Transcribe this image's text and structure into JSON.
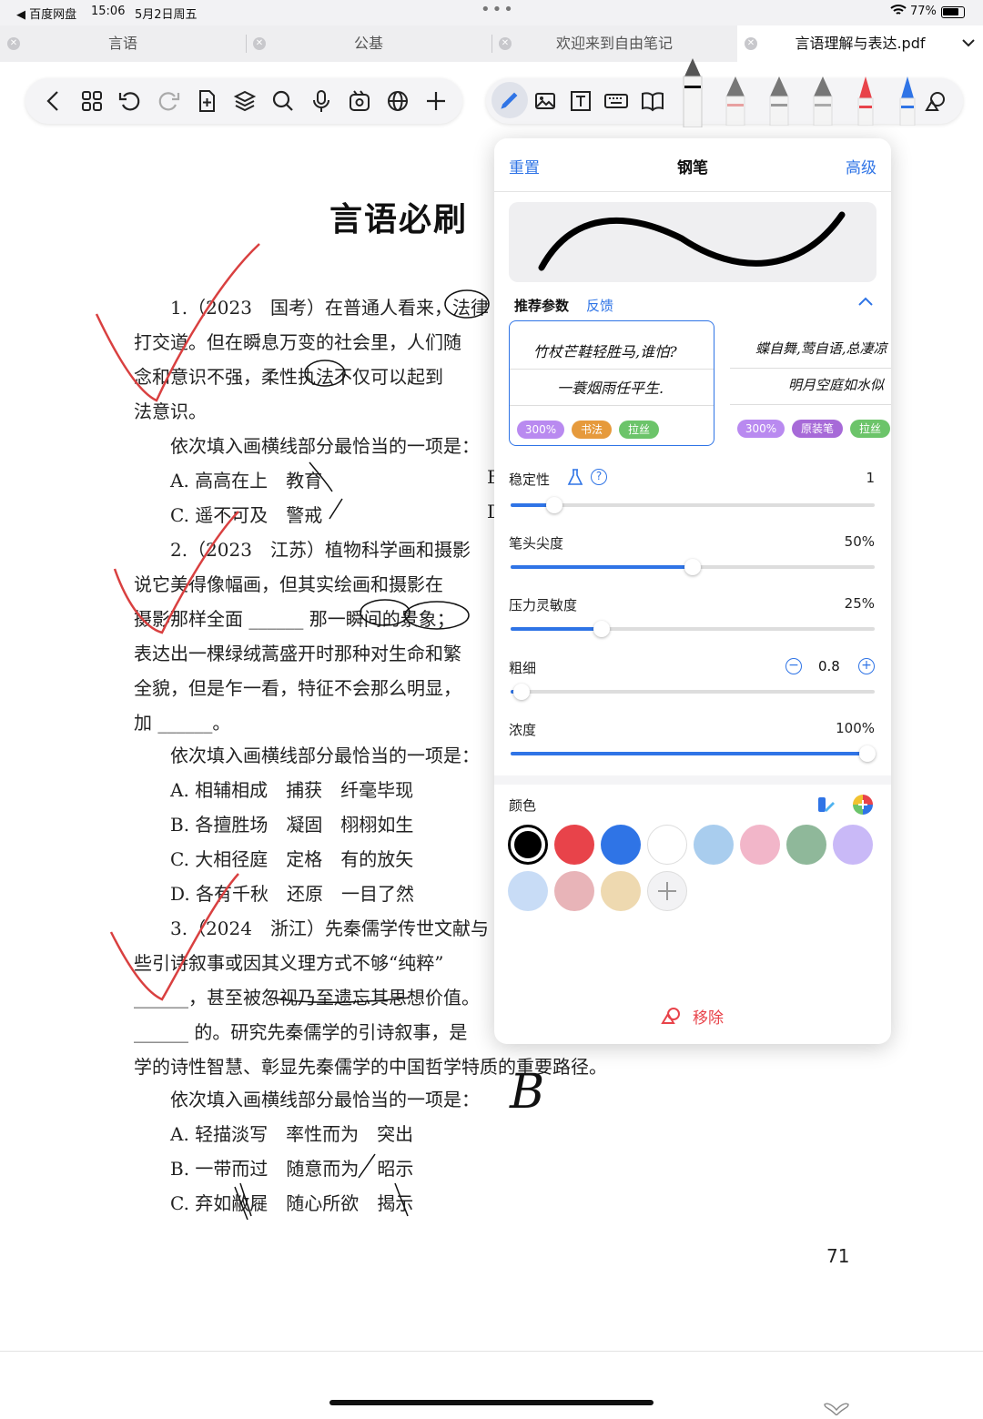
{
  "status": {
    "back_app": "百度网盘",
    "time": "15:06",
    "date": "5月2日周五",
    "battery": "77%"
  },
  "tabs": [
    {
      "label": "言语"
    },
    {
      "label": "公基"
    },
    {
      "label": "欢迎来到自由笔记"
    },
    {
      "label": "言语理解与表达.pdf"
    }
  ],
  "doc": {
    "title": "言语必刷",
    "lines": [
      "1.（2023　国考）在普通人看来，法律",
      "打交道。但在瞬息万变的社会里，人们随",
      "念和意识不强，柔性执法不仅可以起到",
      "法意识。",
      "依次填入画横线部分最恰当的一项是：",
      "A. 高高在上　教育",
      "C. 遥不可及　警戒",
      "2.（2023　江苏）植物科学画和摄影",
      "说它美得像幅画，但其实绘画和摄影在",
      "摄影那样全面 ______ 那一瞬间的景象；",
      "表达出一棵绿绒蒿盛开时那种对生命和繁",
      "全貌，但是乍一看，特征不会那么明显，",
      "加 ______。",
      "依次填入画横线部分最恰当的一项是：",
      "A. 相辅相成　捕获　纤毫毕现",
      "B. 各擅胜场　凝固　栩栩如生",
      "C. 大相径庭　定格　有的放矢",
      "D. 各有千秋　还原　一目了然",
      "3.（2024　浙江）先秦儒学传世文献与",
      "些引诗叙事或因其义理方式不够“纯粹”",
      "______，甚至被忽视乃至遗忘其思想价值。",
      "______ 的。研究先秦儒学的引诗叙事，是",
      "学的诗性智慧、彰显先秦儒学的中国哲学特质的重要路径。",
      "依次填入画横线部分最恰当的一项是：",
      "A. 轻描淡写　率性而为　突出",
      "B. 一带而过　随意而为　昭示",
      "C. 弃如敝屣　随心所欲　揭示"
    ],
    "option_b1": "B",
    "option_d1": "D",
    "answer_mark": "B",
    "page_number": "71"
  },
  "panel": {
    "reset": "重置",
    "title": "钢笔",
    "advanced": "高级",
    "recommended": "推荐参数",
    "feedback": "反馈",
    "preset_cards": [
      {
        "line1": "竹杖芒鞋轻胜马,谁怕?",
        "line2": "一蓑烟雨任平生.",
        "badges": [
          "300%",
          "书法",
          "拉丝"
        ]
      },
      {
        "line1": "蝶自舞,莺自语,总凄凉",
        "line2": "明月空庭如水似",
        "badges": [
          "300%",
          "原装笔",
          "拉丝"
        ]
      }
    ],
    "stability": {
      "label": "稳定性",
      "value": "1",
      "fraction": 0.12
    },
    "tip_sharpness": {
      "label": "笔头尖度",
      "value": "50%",
      "fraction": 0.5
    },
    "pressure": {
      "label": "压力灵敏度",
      "value": "25%",
      "fraction": 0.25
    },
    "thickness": {
      "label": "粗细",
      "value": "0.8",
      "fraction": 0.03
    },
    "opacity": {
      "label": "浓度",
      "value": "100%",
      "fraction": 0.98
    },
    "color_label": "颜色",
    "colors": [
      "#000000",
      "#e8434a",
      "#2f74e6",
      "#ffffff",
      "#a9cdee",
      "#f2b6c9",
      "#8fb89a",
      "#c9b9f7",
      "#c8dcf6",
      "#e8b4b8",
      "#eed9b0"
    ],
    "remove": "移除"
  },
  "accent": "#2f74e6"
}
